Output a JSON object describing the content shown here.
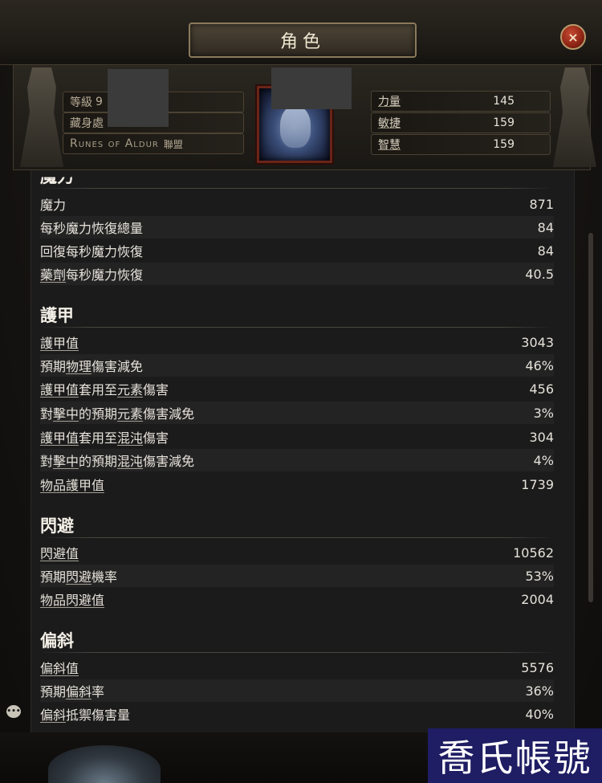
{
  "window": {
    "title": "角色",
    "close_symbol": "×"
  },
  "header": {
    "level_label": "等級",
    "level_value": "9",
    "stash_label": "藏身處",
    "league_name": "Runes of Aldur",
    "league_suffix": "聯盟",
    "attributes": [
      {
        "label": "力量",
        "value": "145"
      },
      {
        "label": "敏捷",
        "value": "159"
      },
      {
        "label": "智慧",
        "value": "159"
      }
    ]
  },
  "sections": {
    "mana": {
      "title": "魔力",
      "rows": [
        {
          "label": "魔力",
          "value": "871"
        },
        {
          "label": "每秒魔力恢復總量",
          "value": "84"
        },
        {
          "label": "回復每秒魔力恢復",
          "value": "84"
        },
        {
          "label_u": "藥劑",
          "label_rest": "每秒魔力恢復",
          "value": "40.5"
        }
      ]
    },
    "armour": {
      "title": "護甲",
      "rows": [
        {
          "value": "3043",
          "label_u": "護甲值"
        },
        {
          "value": "46%",
          "label_a": "預期",
          "label_u": "物理",
          "label_b": "傷害減免"
        },
        {
          "value": "456",
          "label_u": "護甲值",
          "label_a": "套用至",
          "label_u2": "元素",
          "label_b": "傷害"
        },
        {
          "value": "3%",
          "label_a": "對",
          "label_u": "擊中",
          "label_b": "的預期",
          "label_u2": "元素",
          "label_c": "傷害減免"
        },
        {
          "value": "304",
          "label_u": "護甲值",
          "label_a": "套用至",
          "label_u2": "混沌",
          "label_b": "傷害"
        },
        {
          "value": "4%",
          "label_a": "對",
          "label_u": "擊中",
          "label_b": "的預期",
          "label_u2": "混沌",
          "label_c": "傷害減免"
        },
        {
          "value": "1739",
          "label_u": "物品護甲值"
        }
      ]
    },
    "evasion": {
      "title": "閃避",
      "rows": [
        {
          "value": "10562",
          "label_u": "閃避值"
        },
        {
          "value": "53%",
          "label_a": "預期",
          "label_u": "閃避",
          "label_b": "機率"
        },
        {
          "value": "2004",
          "label_u": "物品閃避值"
        }
      ]
    },
    "deflect": {
      "title": "偏斜",
      "rows": [
        {
          "value": "5576",
          "label_u": "偏斜值"
        },
        {
          "value": "36%",
          "label_a": "預期",
          "label_u": "偏斜",
          "label_b": "率"
        },
        {
          "value": "40%",
          "label_u": "偏斜",
          "label_b": "抵禦傷害量"
        }
      ]
    }
  },
  "chat_icon": "chat-bubble",
  "watermark": "喬氏帳號"
}
